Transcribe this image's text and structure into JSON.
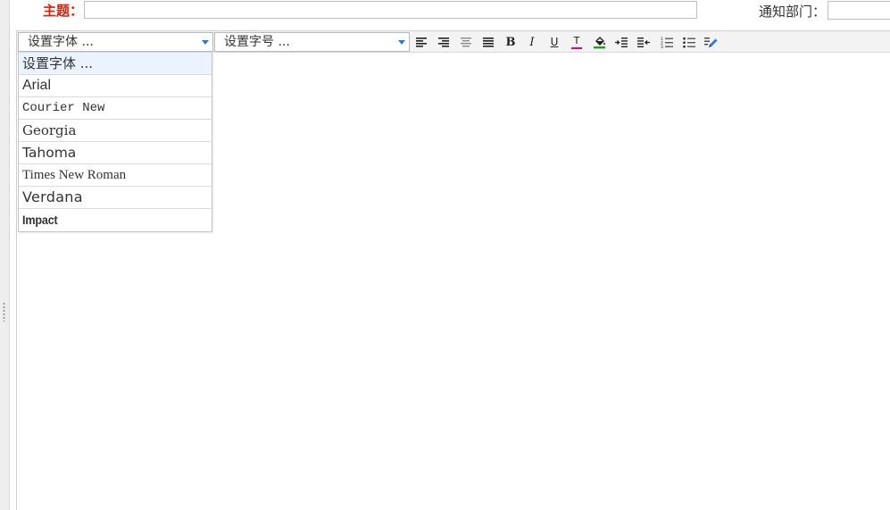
{
  "form": {
    "subject_label": "主题：",
    "subject_value": "",
    "department_label": "通知部门：",
    "department_value": ""
  },
  "toolbar": {
    "font_select": "设置字体 ...",
    "size_select": "设置字号 ...",
    "buttons": [
      {
        "name": "align-left",
        "icon": "align-left-icon"
      },
      {
        "name": "align-right",
        "icon": "align-right-icon"
      },
      {
        "name": "align-center",
        "icon": "align-center-icon"
      },
      {
        "name": "align-justify",
        "icon": "align-justify-icon"
      },
      {
        "name": "bold",
        "label": "B"
      },
      {
        "name": "italic",
        "label": "I"
      },
      {
        "name": "underline",
        "label": "U"
      },
      {
        "name": "font-color",
        "label": "T",
        "color": "#e5007f"
      },
      {
        "name": "background-color",
        "icon": "paint-bucket-icon",
        "color": "#1ea21e"
      },
      {
        "name": "indent",
        "icon": "indent-icon"
      },
      {
        "name": "outdent",
        "icon": "outdent-icon"
      },
      {
        "name": "ordered-list",
        "icon": "ordered-list-icon"
      },
      {
        "name": "unordered-list",
        "icon": "unordered-list-icon"
      },
      {
        "name": "clear-format",
        "icon": "edit-pencil-icon",
        "color": "#2b7bd6"
      }
    ]
  },
  "font_dropdown": {
    "items": [
      "设置字体 ...",
      "Arial",
      "Courier New",
      "Georgia",
      "Tahoma",
      "Times New Roman",
      "Verdana",
      "Impact"
    ],
    "selected_index": 0
  },
  "colors": {
    "subject_label": "#d81e06",
    "accent": "#2b7bd6",
    "font_color_bar": "#e5007f",
    "background_color_bar": "#1ea21e"
  }
}
